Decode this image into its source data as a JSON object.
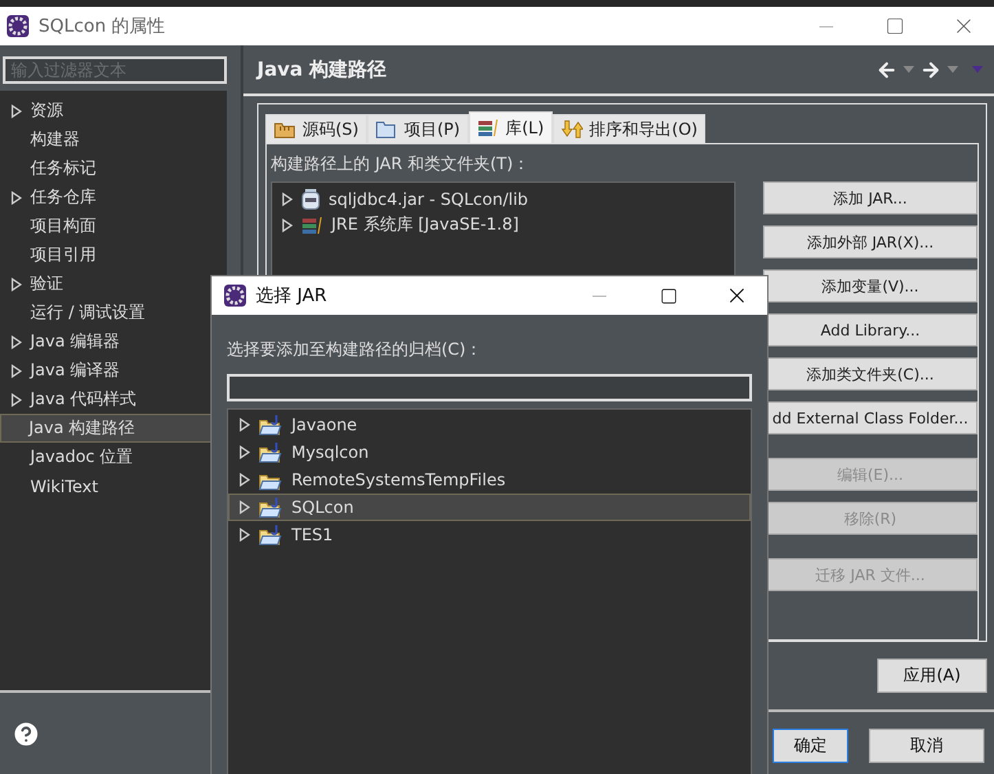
{
  "window": {
    "title": "SQLcon 的属性"
  },
  "filter": {
    "placeholder": "输入过滤器文本"
  },
  "nav": [
    {
      "label": "资源",
      "expandable": true,
      "selected": false
    },
    {
      "label": "构建器",
      "expandable": false,
      "selected": false
    },
    {
      "label": "任务标记",
      "expandable": false,
      "selected": false
    },
    {
      "label": "任务仓库",
      "expandable": true,
      "selected": false
    },
    {
      "label": "项目构面",
      "expandable": false,
      "selected": false
    },
    {
      "label": "项目引用",
      "expandable": false,
      "selected": false
    },
    {
      "label": "验证",
      "expandable": true,
      "selected": false
    },
    {
      "label": "运行 / 调试设置",
      "expandable": false,
      "selected": false
    },
    {
      "label": "Java 编辑器",
      "expandable": true,
      "selected": false
    },
    {
      "label": "Java 编译器",
      "expandable": true,
      "selected": false
    },
    {
      "label": "Java 代码样式",
      "expandable": true,
      "selected": false
    },
    {
      "label": "Java 构建路径",
      "expandable": false,
      "selected": true
    },
    {
      "label": "Javadoc 位置",
      "expandable": false,
      "selected": false
    },
    {
      "label": "WikiText",
      "expandable": false,
      "selected": false
    }
  ],
  "page": {
    "title": "Java 构建路径"
  },
  "tabs": [
    {
      "label": "源码(S)",
      "kind": "source",
      "selected": false
    },
    {
      "label": "项目(P)",
      "kind": "project",
      "selected": false
    },
    {
      "label": "库(L)",
      "kind": "library",
      "selected": true
    },
    {
      "label": "排序和导出(O)",
      "kind": "order",
      "selected": false
    }
  ],
  "libraries": {
    "label": "构建路径上的 JAR 和类文件夹(T)：",
    "items": [
      {
        "label": "sqljdbc4.jar - SQLcon/lib",
        "kind": "jar"
      },
      {
        "label": "JRE 系统库 [JavaSE-1.8]",
        "kind": "library"
      }
    ]
  },
  "action_groups": [
    {
      "buttons": [
        {
          "label": "添加 JAR...",
          "disabled": false
        },
        {
          "label": "添加外部 JAR(X)...",
          "disabled": false
        },
        {
          "label": "添加变量(V)...",
          "disabled": false
        },
        {
          "label": "Add Library...",
          "disabled": false
        },
        {
          "label": "添加类文件夹(C)...",
          "disabled": false
        },
        {
          "label": "dd External Class Folder...",
          "disabled": false
        }
      ]
    },
    {
      "buttons": [
        {
          "label": "编辑(E)...",
          "disabled": true
        },
        {
          "label": "移除(R)",
          "disabled": true
        }
      ]
    },
    {
      "buttons": [
        {
          "label": "迁移 JAR 文件...",
          "disabled": true
        }
      ]
    }
  ],
  "apply": "应用(A)",
  "ok": "确定",
  "cancel": "取消",
  "dialog": {
    "title": "选择 JAR",
    "label": "选择要添加至构建路径的归档(C)：",
    "items": [
      {
        "label": "Javaone",
        "kind": "java_project",
        "selected": false
      },
      {
        "label": "Mysqlcon",
        "kind": "java_project",
        "selected": false
      },
      {
        "label": "RemoteSystemsTempFiles",
        "kind": "folder",
        "selected": false
      },
      {
        "label": "SQLcon",
        "kind": "java_project",
        "selected": true
      },
      {
        "label": "TES1",
        "kind": "java_project",
        "selected": false
      }
    ]
  }
}
